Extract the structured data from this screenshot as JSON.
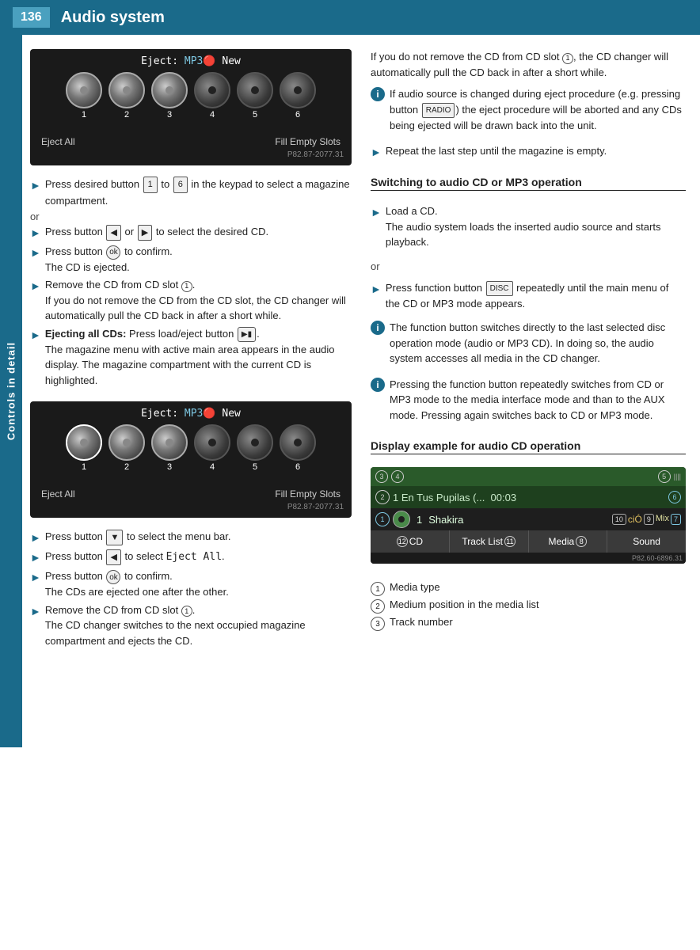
{
  "header": {
    "page_number": "136",
    "title": "Audio system"
  },
  "sidebar": {
    "label": "Controls in detail"
  },
  "cd_display_1": {
    "title": "Eject: ᴹᴘ³① New",
    "slots": [
      1,
      2,
      3,
      4,
      5,
      6
    ],
    "bottom_left": "Eject All",
    "bottom_right": "Fill Empty Slots",
    "code": "P82.87-2077.31"
  },
  "cd_display_2": {
    "title": "Eject: ᴹᴘ³① New",
    "slots": [
      1,
      2,
      3,
      4,
      5,
      6
    ],
    "bottom_left": "Eject All",
    "bottom_right": "Fill Empty Slots",
    "code": "P82.87-2077.31"
  },
  "instructions_left": [
    {
      "type": "arrow",
      "text": "Press desired button",
      "btn1": "1",
      "between": "to",
      "btn2": "6",
      "suffix": "in the keypad to select a magazine compartment."
    },
    {
      "type": "or"
    },
    {
      "type": "arrow",
      "text": "Press button",
      "btn1": "◄",
      "between": "or",
      "btn2": "►",
      "suffix": "to select the desired CD."
    },
    {
      "type": "arrow",
      "text": "Press button ⓄⓄ to confirm.\nThe CD is ejected."
    },
    {
      "type": "arrow",
      "text": "Remove the CD from CD slot ①.\nIf you do not remove the CD from the CD slot, the CD changer will automatically pull the CD back in after a short while."
    },
    {
      "type": "arrow",
      "bold_prefix": "Ejecting all CDs:",
      "text": "Press load/eject button ⓄⓄ.\nThe magazine menu with active main area appears in the audio display. The magazine compartment with the current CD is highlighted."
    }
  ],
  "instructions_left2": [
    {
      "type": "arrow",
      "text": "Press button ▼ to select the menu bar."
    },
    {
      "type": "arrow",
      "text": "Press button ◄ to select Eject All."
    },
    {
      "type": "arrow",
      "text": "Press button ⓄⓄ to confirm.\nThe CDs are ejected one after the other."
    },
    {
      "type": "arrow",
      "text": "Remove the CD from CD slot ①.\nThe CD changer switches to the next occupied magazine compartment and ejects the CD."
    }
  ],
  "right_col": {
    "para1": "If you do not remove the CD from CD slot ①, the CD changer will automatically pull the CD back in after a short while.",
    "info1": "If audio source is changed during eject procedure (e.g. pressing button RADIO) the eject procedure will be aborted and any CDs being ejected will be drawn back into the unit.",
    "bullet1": "Repeat the last step until the magazine is empty.",
    "section_heading": "Switching to audio CD or MP3 operation",
    "load_cd": "Load a CD.\nThe audio system loads the inserted audio source and starts playback.",
    "or_text": "or",
    "disc_instr": "Press function button DISC repeatedly until the main menu of the CD or MP3 mode appears.",
    "info2": "The function button switches directly to the last selected disc operation mode (audio or MP3 CD). In doing so, the audio system accesses all media in the CD changer.",
    "info3": "Pressing the function button repeatedly switches from CD or MP3 mode to the media interface mode and than to the AUX mode. Pressing again switches back to CD or MP3 mode.",
    "display_heading": "Display example for audio CD operation",
    "display_track": "1 En Tus Pupilas (... 00:03",
    "display_artist": "Shakira",
    "display_code": "P82.60-6896.31",
    "bottom_items": [
      "CD 12",
      "Track List 11",
      "Media 8",
      "Sound"
    ],
    "legend": [
      {
        "num": "1",
        "text": "Media type"
      },
      {
        "num": "2",
        "text": "Medium position in the media list"
      },
      {
        "num": "3",
        "text": "Track number"
      }
    ]
  }
}
